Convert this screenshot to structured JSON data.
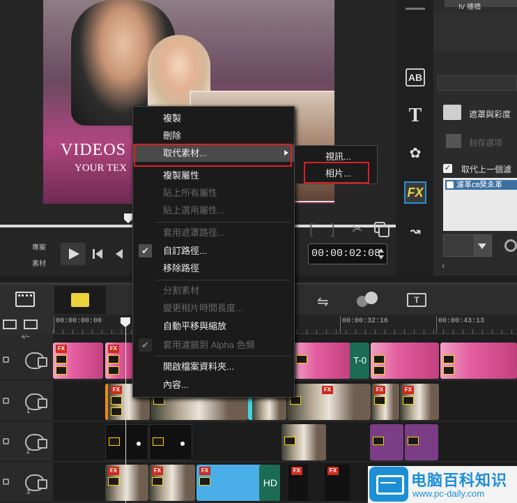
{
  "preview": {
    "title_text": "VIDEOS",
    "subtitle_text": "YOUR TEX",
    "project_label": "專案",
    "clip_label": "素材",
    "timecode": "00:00:02:08"
  },
  "right_panel": {
    "top_dropdown": "Ⅳ 樓橋",
    "color_row": "遮罩與彩度",
    "custom_row": "封存選項",
    "replace_row": "取代上一個濾",
    "replace_checked": true,
    "filter_item": "濾革㎝癸ゑ革"
  },
  "timeline": {
    "ruler": [
      "00:00:00:00",
      "00:00:32:16",
      "00:00:43:13"
    ],
    "add_track": "+∕−",
    "tracks": [
      {
        "label": ""
      },
      {
        "label": "1"
      },
      {
        "label": "2"
      },
      {
        "label": "3"
      }
    ],
    "clip_text_t": "T-0",
    "clip_text_hd": "HD"
  },
  "context_menu": {
    "items": [
      {
        "label": "複製",
        "enabled": true
      },
      {
        "label": "刪除",
        "enabled": true
      },
      {
        "label": "取代素材...",
        "enabled": true,
        "submenu": true
      },
      {
        "label": "複製屬性",
        "enabled": true
      },
      {
        "label": "貼上所有屬性",
        "enabled": false
      },
      {
        "label": "貼上選用屬性...",
        "enabled": false
      },
      {
        "label": "套用遮罩路徑...",
        "enabled": false
      },
      {
        "label": "自訂路徑...",
        "enabled": true,
        "checked": true
      },
      {
        "label": "移除路徑",
        "enabled": true
      },
      {
        "label": "分割素材",
        "enabled": false
      },
      {
        "label": "變更相片時間長度...",
        "enabled": false
      },
      {
        "label": "自動平移與縮放",
        "enabled": true
      },
      {
        "label": "套用濾鏡到 Alpha 色頻",
        "enabled": false,
        "checked": true
      },
      {
        "label": "開啟檔案資料夾...",
        "enabled": true
      },
      {
        "label": "內容...",
        "enabled": true
      }
    ],
    "submenu": [
      "視訊...",
      "相片..."
    ]
  },
  "watermark": {
    "title": "电脑百科知识",
    "url": "www.pc-daily.com"
  }
}
